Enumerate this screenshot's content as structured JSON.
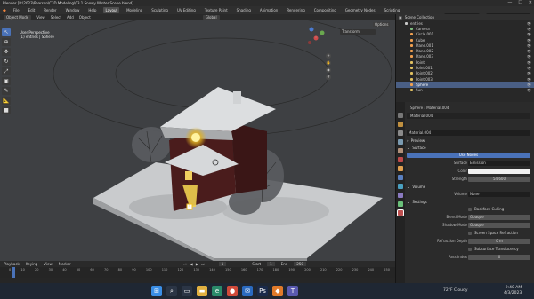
{
  "window": {
    "title": "Blender [P:\\2023\\Pearson\\C3D Modeling\\03.1 Snowy Winter Scene.blend]",
    "controls": [
      "—",
      "☐",
      "✕"
    ]
  },
  "menu": {
    "items": [
      "File",
      "Edit",
      "Render",
      "Window",
      "Help"
    ],
    "tabs": [
      "Layout",
      "Modeling",
      "Sculpting",
      "UV Editing",
      "Texture Paint",
      "Shading",
      "Animation",
      "Rendering",
      "Compositing",
      "Geometry Nodes",
      "Scripting"
    ],
    "active_tab": "Layout",
    "scene": "Scene",
    "view_layer": "View Layer"
  },
  "viewport_header": {
    "mode": "Object Mode",
    "items": [
      "View",
      "Select",
      "Add",
      "Object"
    ],
    "orientation": "Global",
    "options": "Options"
  },
  "viewport": {
    "info_line1": "User Perspective",
    "info_line2": "(1) entries | Sphere",
    "transform_tab": "Transform"
  },
  "timeline": {
    "items": [
      "Playback",
      "Keying",
      "View",
      "Marker"
    ],
    "current_frame": "1",
    "start_label": "Start",
    "start": "1",
    "end_label": "End",
    "end": "250",
    "ticks": [
      "0",
      "10",
      "20",
      "30",
      "40",
      "50",
      "60",
      "70",
      "80",
      "90",
      "100",
      "110",
      "120",
      "130",
      "140",
      "150",
      "160",
      "170",
      "180",
      "190",
      "200",
      "210",
      "220",
      "230",
      "240",
      "250"
    ]
  },
  "outliner": {
    "header": "Scene Collection",
    "items": [
      {
        "name": "entries",
        "color": "#c8c8c8",
        "selected": false
      },
      {
        "name": "Camera",
        "color": "#7fbf7f",
        "selected": false
      },
      {
        "name": "Circle.001",
        "color": "#f0a050",
        "selected": false
      },
      {
        "name": "Cube",
        "color": "#f0a050",
        "selected": false
      },
      {
        "name": "Plane.001",
        "color": "#f0a050",
        "selected": false
      },
      {
        "name": "Plane.002",
        "color": "#f0a050",
        "selected": false
      },
      {
        "name": "Plane.003",
        "color": "#f0a050",
        "selected": false
      },
      {
        "name": "Point",
        "color": "#e0c060",
        "selected": false
      },
      {
        "name": "Point.001",
        "color": "#e0c060",
        "selected": false
      },
      {
        "name": "Point.002",
        "color": "#e0c060",
        "selected": false
      },
      {
        "name": "Point.003",
        "color": "#e0c060",
        "selected": false
      },
      {
        "name": "Sphere",
        "color": "#f0a050",
        "selected": true
      },
      {
        "name": "Sun",
        "color": "#e0c060",
        "selected": false
      }
    ]
  },
  "properties": {
    "breadcrumb": "Sphere  ›  Material.004",
    "slot": "Material.004",
    "material": "Material.004",
    "preview": "Preview",
    "surface": "Surface",
    "use_nodes": "Use Nodes",
    "surface_label": "Surface",
    "surface_value": "Emission",
    "color_label": "Color",
    "strength_label": "Strength",
    "strength_value": "54.600",
    "volume": "Volume",
    "volume_label": "Volume",
    "volume_value": "None",
    "settings": "Settings",
    "backface": "Backface Culling",
    "blend_label": "Blend Mode",
    "blend_value": "Opaque",
    "shadow_label": "Shadow Mode",
    "shadow_value": "Opaque",
    "ssr": "Screen Space Refraction",
    "refr_label": "Refraction Depth",
    "refr_value": "0 m",
    "sss": "Subsurface Translucency",
    "pass_label": "Pass Index",
    "pass_value": "0"
  },
  "taskbar": {
    "weather": "72°F  Cloudy",
    "time": "9:40 AM",
    "date": "4/3/2023"
  }
}
